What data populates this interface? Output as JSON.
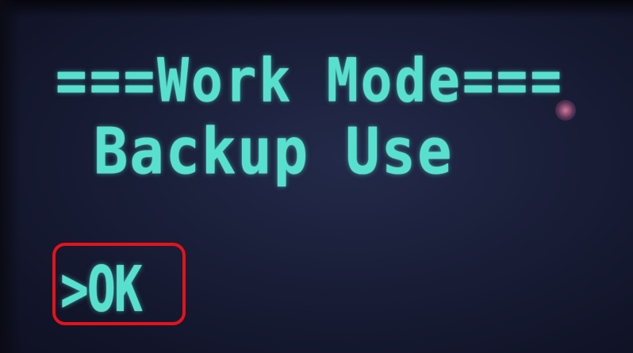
{
  "display": {
    "title": "===Work Mode===",
    "mode_value": "Backup Use",
    "ok_option": ">OK",
    "text_color": "#58e0cf",
    "background_color": "#1a1f3a",
    "highlight_color": "#e3131b"
  }
}
